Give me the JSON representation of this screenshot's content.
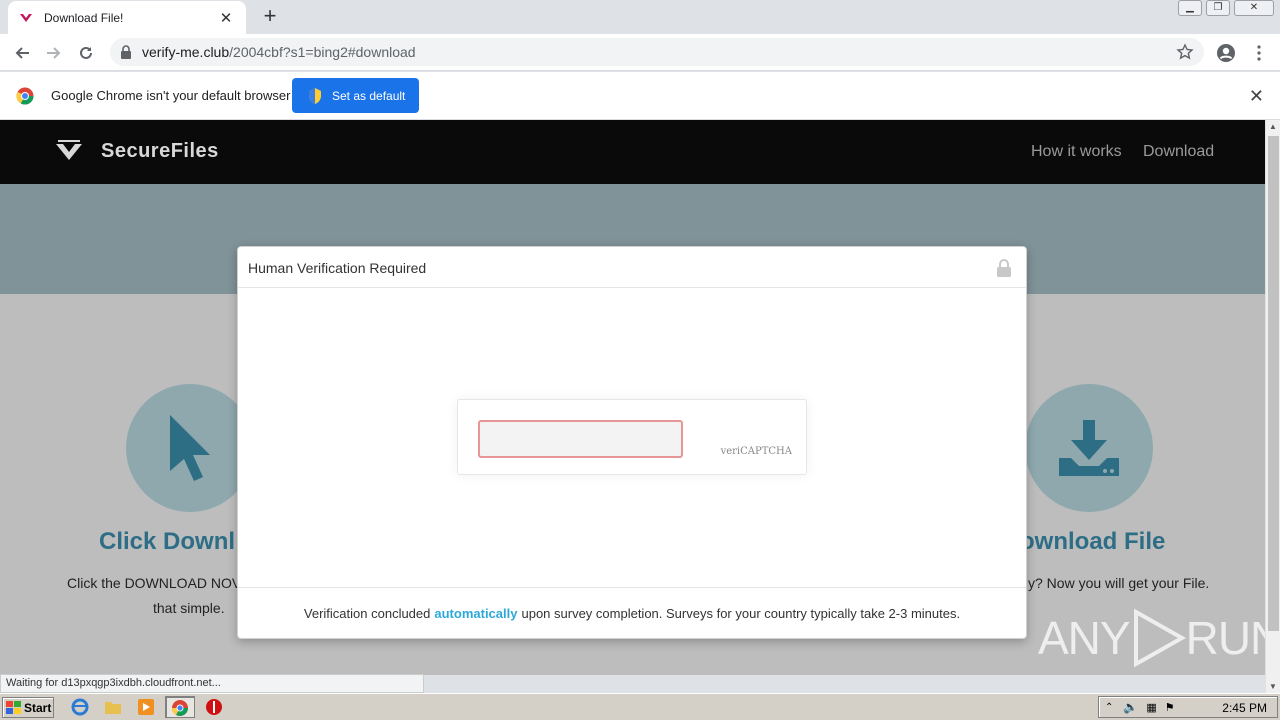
{
  "browser": {
    "tab_title": "Download File!",
    "url_host": "verify-me.club",
    "url_path": "/2004cbf?s1=bing2#download",
    "infobar_message": "Google Chrome isn't your default browser",
    "set_default_label": "Set as default",
    "status_text": "Waiting for d13pxqgp3ixdbh.cloudfront.net..."
  },
  "site": {
    "brand": "SecureFiles",
    "nav": [
      "How it works",
      "Download"
    ],
    "features": [
      {
        "title": "Click Downl",
        "text_line1": "Click the DOWNLOAD NOV",
        "text_line2": "that simple."
      },
      {
        "title": "ownload File",
        "text_line1": "y? Now you will get your File."
      }
    ]
  },
  "modal": {
    "title": "Human Verification Required",
    "captcha_label": "veriCAPTCHA",
    "footer_before": "Verification concluded",
    "footer_highlight": "automatically",
    "footer_after": "upon survey completion. Surveys for your country typically take 2-3 minutes."
  },
  "watermark": {
    "left": "ANY",
    "right": "RUN"
  },
  "taskbar": {
    "start_label": "Start",
    "clock": "2:45 PM"
  }
}
